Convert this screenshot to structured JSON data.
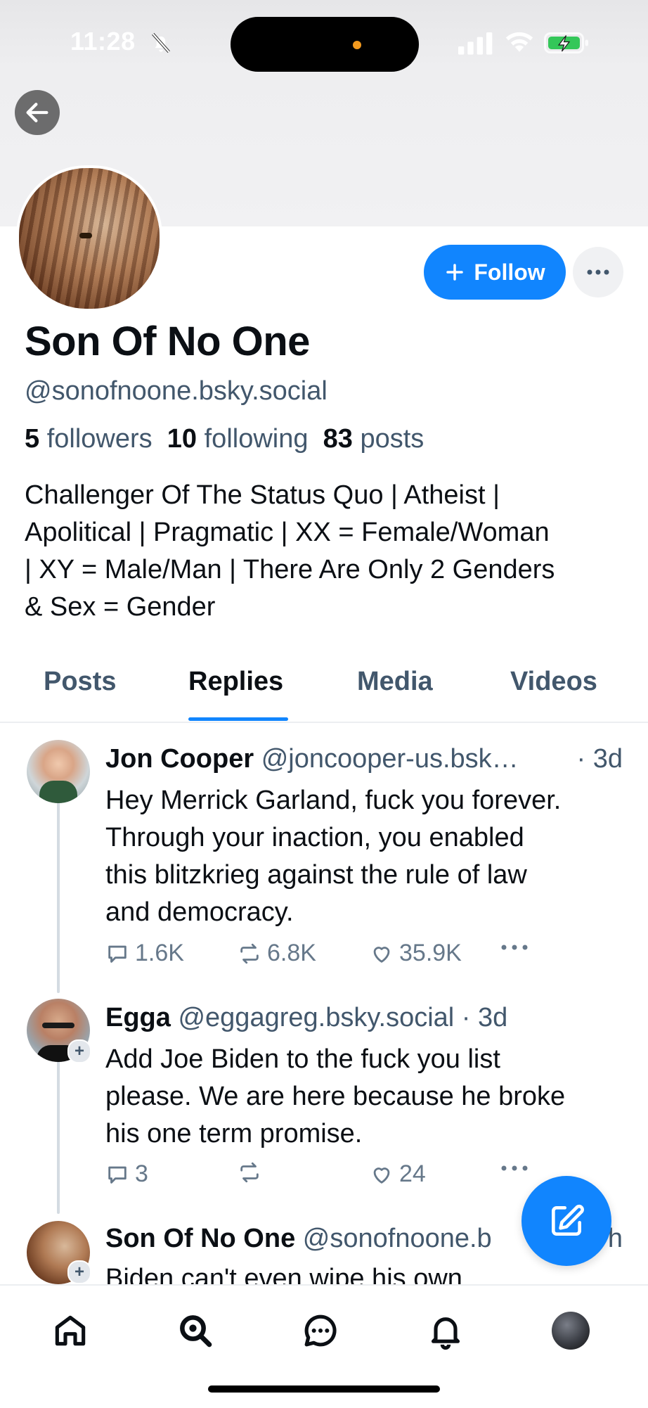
{
  "status_bar": {
    "time": "11:28"
  },
  "profile": {
    "name": "Son Of No One",
    "handle": "@sonofnoone.bsky.social",
    "follow_label": "Follow",
    "stats": {
      "followers_count": "5",
      "followers_label": "followers",
      "following_count": "10",
      "following_label": "following",
      "posts_count": "83",
      "posts_label": "posts"
    },
    "bio": "Challenger Of The Status Quo | Atheist |\nApolitical | Pragmatic | XX = Female/Woman\n| XY = Male/Man | There Are Only 2 Genders\n& Sex = Gender"
  },
  "tabs": [
    {
      "label": "Posts"
    },
    {
      "label": "Replies",
      "active": true
    },
    {
      "label": "Media"
    },
    {
      "label": "Videos"
    }
  ],
  "posts": [
    {
      "name": "Jon Cooper",
      "handle": "@joncooper-us.bsk…",
      "time": "· 3d",
      "text": "Hey Merrick Garland, fuck you forever.\nThrough your inaction, you enabled\nthis blitzkrieg against the rule of law\nand democracy.",
      "replies": "1.6K",
      "reposts": "6.8K",
      "likes": "35.9K"
    },
    {
      "name": "Egga",
      "handle": "@eggagreg.bsky.social",
      "time": "· 3d",
      "text": "Add Joe Biden to the fuck you list\nplease. We are here because he broke\nhis one term promise.",
      "replies": "3",
      "reposts": "",
      "likes": "24"
    },
    {
      "name": "Son Of No One",
      "handle": "@sonofnoone.b",
      "time": "h",
      "text": "Biden can't even wipe his own"
    }
  ],
  "icons": {
    "back": "arrow-left-icon",
    "more": "ellipsis-icon",
    "compose": "compose-icon",
    "nav": [
      "home-icon",
      "search-icon",
      "chat-icon",
      "bell-icon",
      "profile-avatar"
    ]
  },
  "colors": {
    "accent": "#1185fe",
    "muted_text": "#42576c",
    "text": "#0b0f14"
  }
}
